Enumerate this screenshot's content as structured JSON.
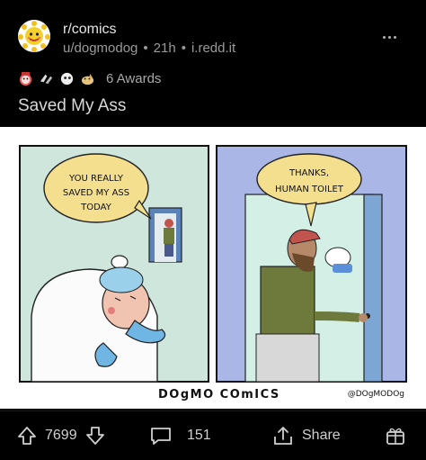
{
  "post": {
    "subreddit": "r/comics",
    "author": "u/dogmodog",
    "time": "21h",
    "domain": "i.redd.it",
    "separator": "•",
    "awards_count": "6 Awards",
    "title": "Saved My Ass"
  },
  "image": {
    "bubble_left": [
      "YOU REALLY",
      "SAVED MY ASS",
      "TODAY"
    ],
    "bubble_right": [
      "THANKS,",
      "HUMAN TOILET"
    ],
    "footer_left": "DOgMO COmICS",
    "footer_right": "@DOgMODOg"
  },
  "actions": {
    "votes": "7699",
    "comments": "151",
    "share_label": "Share"
  },
  "colors": {
    "background": "#000000",
    "panel_left": "#cfe6dc",
    "panel_right": "#a9b6e6",
    "bubble": "#f4df8f"
  }
}
